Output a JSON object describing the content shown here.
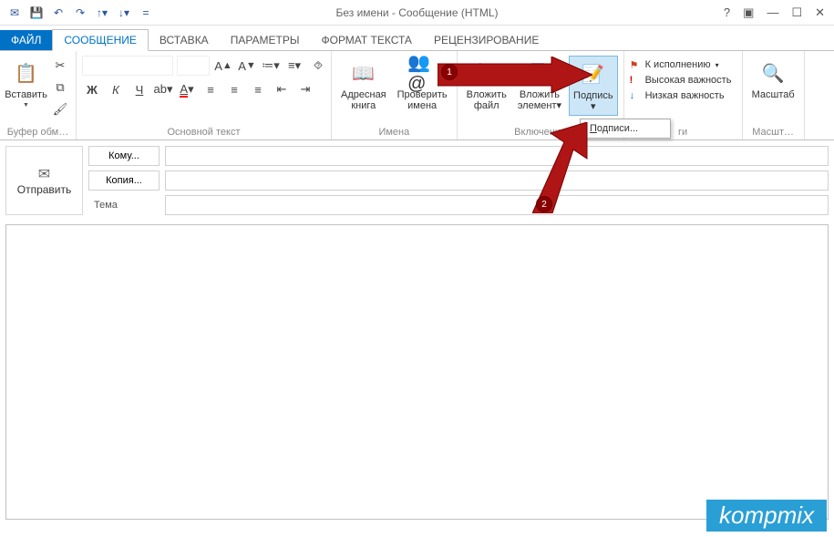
{
  "title": "Без имени - Сообщение (HTML)",
  "tabs": {
    "file": "ФАЙЛ",
    "message": "СООБЩЕНИЕ",
    "insert": "ВСТАВКА",
    "options": "ПАРАМЕТРЫ",
    "format": "ФОРМАТ ТЕКСТА",
    "review": "РЕЦЕНЗИРОВАНИЕ"
  },
  "ribbon": {
    "clipboard": {
      "label": "Буфер обм…",
      "paste": "Вставить"
    },
    "basic_text": {
      "label": "Основной текст",
      "bold": "Ж",
      "italic": "К",
      "underline": "Ч"
    },
    "names": {
      "label": "Имена",
      "addr_book_l1": "Адресная",
      "addr_book_l2": "книга",
      "check_l1": "Проверить",
      "check_l2": "имена"
    },
    "include": {
      "label": "Включение",
      "attach_file_l1": "Вложить",
      "attach_file_l2": "файл",
      "attach_item_l1": "Вложить",
      "attach_item_l2": "элемент",
      "signature": "Подпись"
    },
    "tags": {
      "label": "ги",
      "follow": "К исполнению",
      "high": "Высокая важность",
      "low": "Низкая важность"
    },
    "zoom": {
      "label": "Масшт…",
      "zoom": "Масштаб"
    }
  },
  "dropdown": {
    "signatures": "Подписи..."
  },
  "fields": {
    "send": "Отправить",
    "to": "Кому...",
    "cc": "Копия...",
    "subject": "Тема"
  },
  "badges": {
    "one": "1",
    "two": "2"
  },
  "watermark": "kompmix"
}
